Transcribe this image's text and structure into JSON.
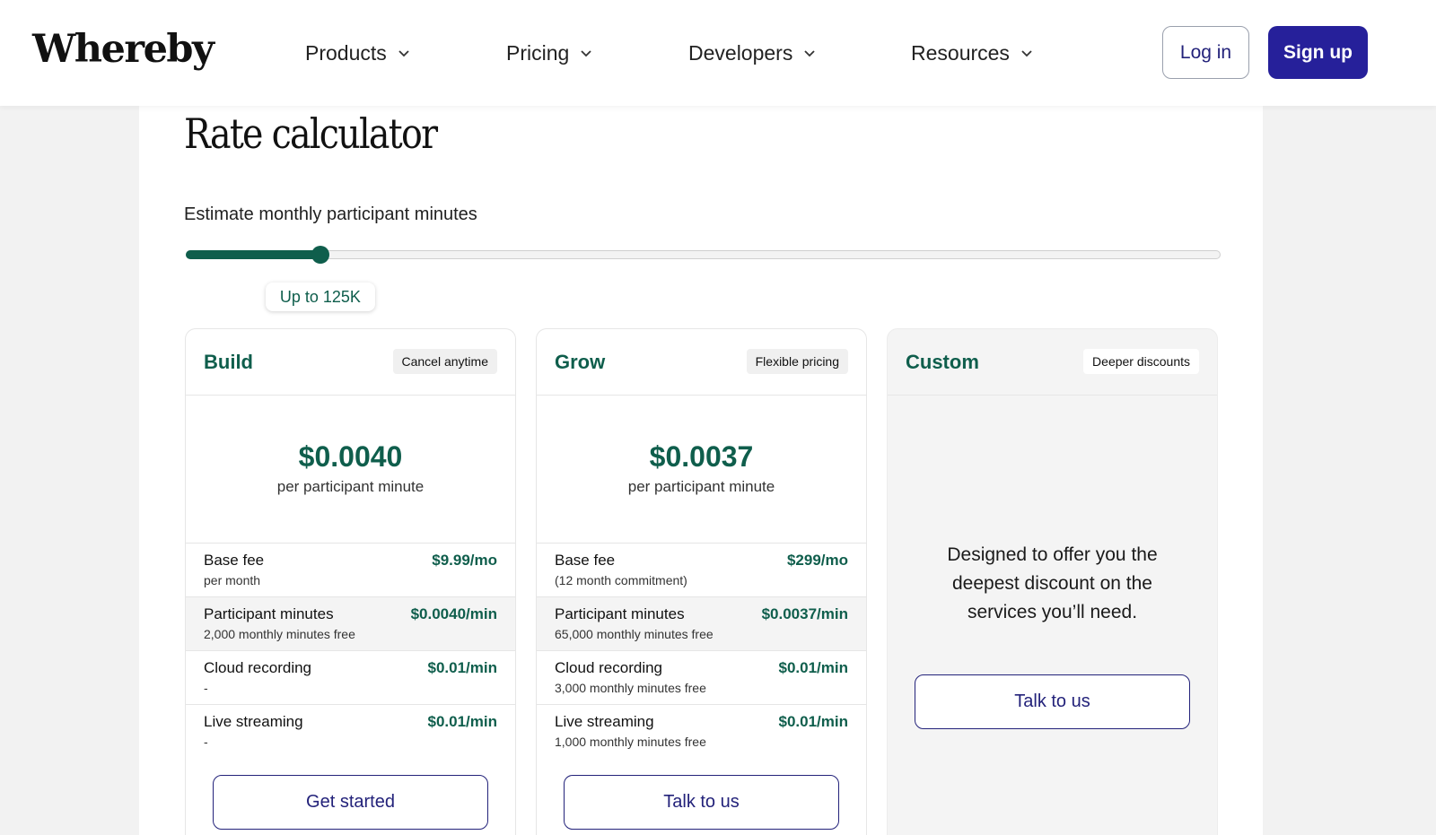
{
  "header": {
    "logo": "Whereby",
    "nav": [
      {
        "label": "Products"
      },
      {
        "label": "Pricing"
      },
      {
        "label": "Developers"
      },
      {
        "label": "Resources"
      }
    ],
    "login_label": "Log in",
    "signup_label": "Sign up"
  },
  "calculator": {
    "title": "Rate calculator",
    "slider_label": "Estimate monthly participant minutes",
    "slider_value_label": "Up to 125K",
    "slider_fraction": 0.13
  },
  "plans": [
    {
      "name": "Build",
      "badge": "Cancel anytime",
      "price": "$0.0040",
      "price_unit": "per participant minute",
      "rows": [
        {
          "title": "Base fee",
          "sub": "per month",
          "price": "$9.99/mo"
        },
        {
          "title": "Participant minutes",
          "sub": "2,000 monthly minutes free",
          "price": "$0.0040/min"
        },
        {
          "title": "Cloud recording",
          "sub": "-",
          "price": "$0.01/min"
        },
        {
          "title": "Live streaming",
          "sub": "-",
          "price": "$0.01/min"
        }
      ],
      "cta": "Get started"
    },
    {
      "name": "Grow",
      "badge": "Flexible pricing",
      "price": "$0.0037",
      "price_unit": "per participant minute",
      "rows": [
        {
          "title": "Base fee",
          "sub": "(12 month commitment)",
          "price": "$299/mo"
        },
        {
          "title": "Participant minutes",
          "sub": "65,000 monthly minutes free",
          "price": "$0.0037/min"
        },
        {
          "title": "Cloud recording",
          "sub": "3,000 monthly minutes free",
          "price": "$0.01/min"
        },
        {
          "title": "Live streaming",
          "sub": "1,000 monthly minutes free",
          "price": "$0.01/min"
        }
      ],
      "cta": "Talk to us"
    },
    {
      "name": "Custom",
      "badge": "Deeper discounts",
      "description": "Designed to offer you the deepest discount on the services you’ll need.",
      "cta": "Talk to us"
    }
  ],
  "colors": {
    "brand_green": "#0f5e4c",
    "brand_navy": "#26209a",
    "background": "#f2f2f2"
  }
}
